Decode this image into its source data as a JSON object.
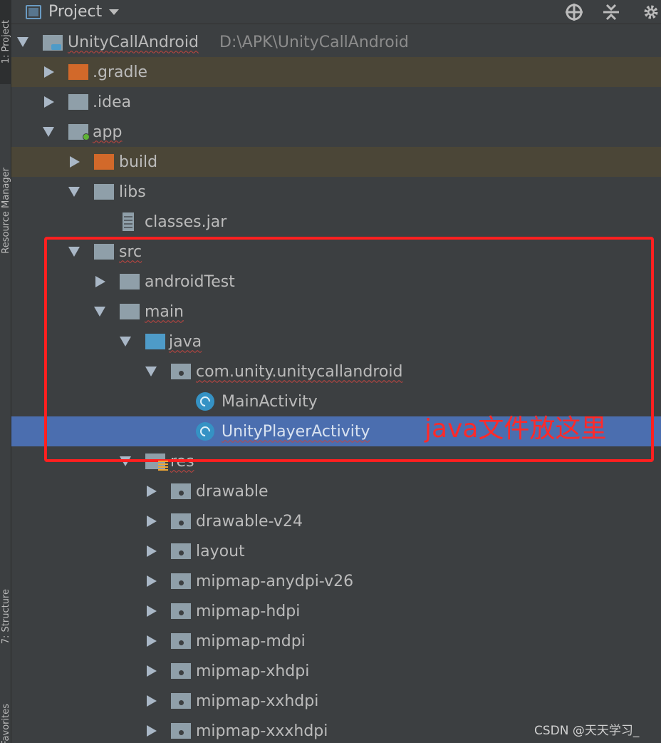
{
  "sidebar": {
    "tabs": [
      {
        "label": "1: Project"
      },
      {
        "label": "Resource Manager"
      },
      {
        "label": "7: Structure"
      },
      {
        "label": "Favorites"
      }
    ]
  },
  "header": {
    "title": "Project"
  },
  "tree": {
    "project": {
      "name": "UnityCallAndroid",
      "path": "D:\\APK\\UnityCallAndroid"
    },
    "gradle": ".gradle",
    "idea": ".idea",
    "app": "app",
    "build": "build",
    "libs": "libs",
    "classes_jar": "classes.jar",
    "src": "src",
    "androidTest": "androidTest",
    "main": "main",
    "java": "java",
    "package": "com.unity.unitycallandroid",
    "main_activity": "MainActivity",
    "unity_player_activity": "UnityPlayerActivity",
    "res": "res",
    "res_children": [
      "drawable",
      "drawable-v24",
      "layout",
      "mipmap-anydpi-v26",
      "mipmap-hdpi",
      "mipmap-mdpi",
      "mipmap-xhdpi",
      "mipmap-xxhdpi",
      "mipmap-xxxhdpi"
    ]
  },
  "annotation": {
    "text": "java文件放这里"
  },
  "watermark": "CSDN @天天学习_",
  "colors": {
    "background": "#3c3f41",
    "selection": "#4b6eaf",
    "annotation": "#ff2020"
  }
}
